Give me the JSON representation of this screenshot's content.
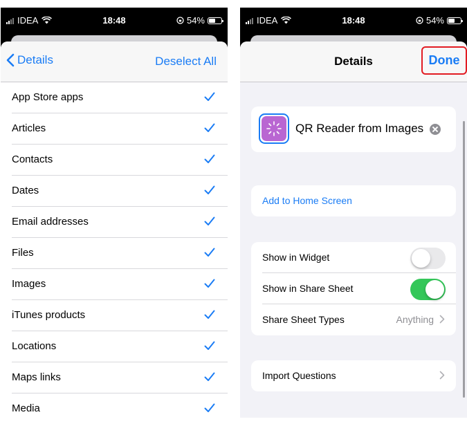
{
  "status_bar": {
    "carrier": "IDEA",
    "time": "18:48",
    "battery": "54%"
  },
  "left": {
    "back_label": "Details",
    "deselect_label": "Deselect All",
    "items": [
      {
        "label": "App Store apps"
      },
      {
        "label": "Articles"
      },
      {
        "label": "Contacts"
      },
      {
        "label": "Dates"
      },
      {
        "label": "Email addresses"
      },
      {
        "label": "Files"
      },
      {
        "label": "Images"
      },
      {
        "label": "iTunes products"
      },
      {
        "label": "Locations"
      },
      {
        "label": "Maps links"
      },
      {
        "label": "Media"
      }
    ]
  },
  "right": {
    "title": "Details",
    "done_label": "Done",
    "shortcut_name": "QR Reader from Images",
    "add_home_label": "Add to Home Screen",
    "settings": {
      "widget_label": "Show in Widget",
      "widget_on": false,
      "share_sheet_label": "Show in Share Sheet",
      "share_sheet_on": true,
      "types_label": "Share Sheet Types",
      "types_value": "Anything"
    },
    "import_label": "Import Questions"
  },
  "colors": {
    "accent": "#1a7cf5",
    "toggle_on": "#34c759",
    "highlight": "#e21b22",
    "icon": "#b966d2"
  }
}
